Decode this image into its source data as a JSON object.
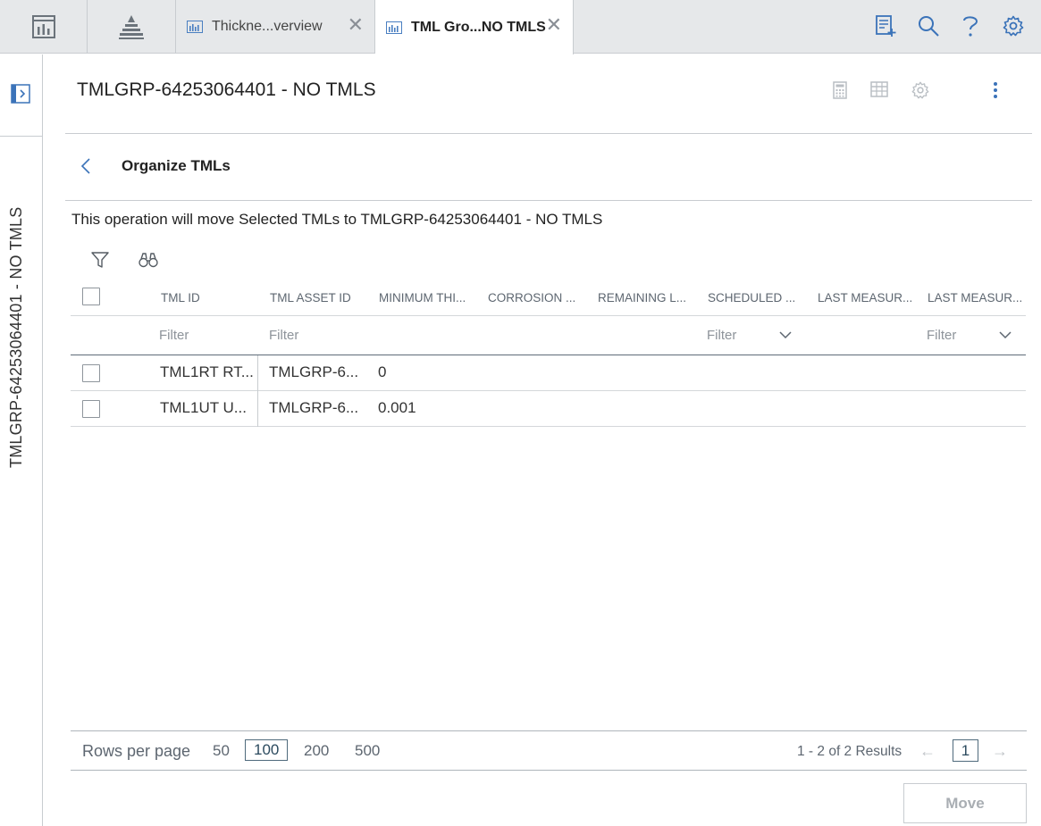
{
  "tabs": [
    {
      "label": "Thickne...verview",
      "active": false
    },
    {
      "label": "TML Gro...NO TMLS",
      "active": true
    }
  ],
  "icons": {
    "home": "dashboard-icon",
    "hierarchy": "asset-hierarchy-icon",
    "tab": "chart-icon",
    "close": "close-icon",
    "queue": "add-queue-icon",
    "search": "search-icon",
    "help": "help-icon",
    "settings": "gear-icon"
  },
  "rail": {
    "title": "TMLGRP-64253064401 - NO TMLS"
  },
  "header": {
    "title": "TMLGRP-64253064401 - NO TMLS"
  },
  "panel": {
    "title": "Organize TMLs",
    "message": "This operation will move Selected TMLs to TMLGRP-64253064401 - NO TMLS"
  },
  "grid": {
    "columns": [
      "TML ID",
      "TML ASSET ID",
      "MINIMUM THI...",
      "CORROSION ...",
      "REMAINING L...",
      "SCHEDULED ...",
      "LAST MEASUR...",
      "LAST MEASUR..."
    ],
    "filter_placeholder": "Filter",
    "rows": [
      {
        "tml_id": "TML1RT RT...",
        "asset_id": "TMLGRP-6...",
        "min_thickness": "0"
      },
      {
        "tml_id": "TML1UT U...",
        "asset_id": "TMLGRP-6...",
        "min_thickness": "0.001"
      }
    ]
  },
  "pager": {
    "rows_per_page_label": "Rows per page",
    "options": [
      "50",
      "100",
      "200",
      "500"
    ],
    "selected": "100",
    "results": "1 - 2 of 2 Results",
    "prev": "←",
    "next": "→",
    "page": "1"
  },
  "actions": {
    "move": "Move"
  },
  "colors": {
    "accent": "#3b73b9",
    "icon_gray": "#b9bec3",
    "border": "#c8ccd0"
  }
}
